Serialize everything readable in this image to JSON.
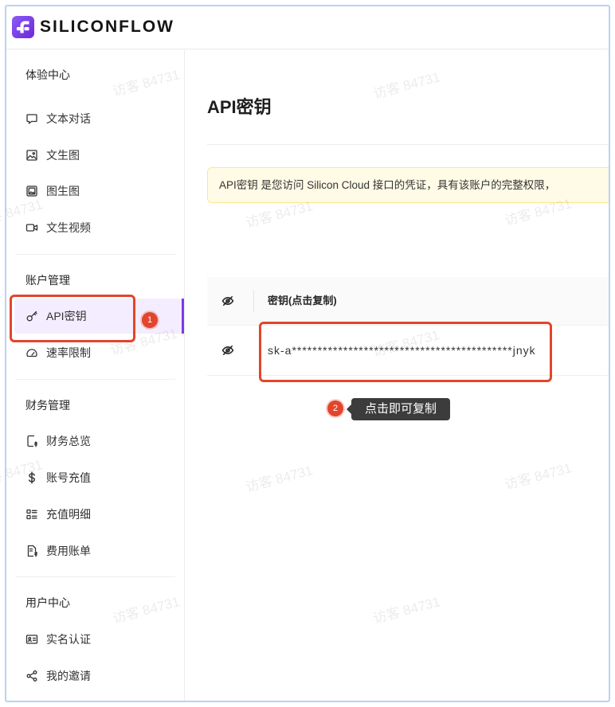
{
  "brand": {
    "name": "SILICONFLOW",
    "logo_icon": "siliconflow-logo-icon"
  },
  "sidebar": {
    "sections": [
      {
        "title": "体验中心",
        "items": [
          {
            "label": "文本对话",
            "icon": "chat-icon"
          },
          {
            "label": "文生图",
            "icon": "image-icon"
          },
          {
            "label": "图生图",
            "icon": "image-to-image-icon"
          },
          {
            "label": "文生视频",
            "icon": "video-icon"
          }
        ]
      },
      {
        "title": "账户管理",
        "items": [
          {
            "label": "API密钥",
            "icon": "key-icon",
            "active": true
          },
          {
            "label": "速率限制",
            "icon": "gauge-icon"
          }
        ]
      },
      {
        "title": "财务管理",
        "items": [
          {
            "label": "财务总览",
            "icon": "finance-overview-icon"
          },
          {
            "label": "账号充值",
            "icon": "dollar-icon"
          },
          {
            "label": "充值明细",
            "icon": "list-icon"
          },
          {
            "label": "费用账单",
            "icon": "bill-icon"
          }
        ]
      },
      {
        "title": "用户中心",
        "items": [
          {
            "label": "实名认证",
            "icon": "id-card-icon"
          },
          {
            "label": "我的邀请",
            "icon": "share-icon"
          }
        ]
      }
    ]
  },
  "main": {
    "title": "API密钥",
    "notice": "API密钥 是您访问 Silicon Cloud 接口的凭证，具有该账户的完整权限，",
    "table": {
      "header_icon": "eye-slash-icon",
      "key_header": "密钥(点击复制)",
      "rows": [
        {
          "visibility_icon": "eye-slash-icon",
          "key": "sk-a*******************************************jnyk"
        }
      ]
    }
  },
  "annotations": {
    "step_1": "1",
    "step_2": "2",
    "tooltip": "点击即可复制"
  },
  "watermark": "访客 84731",
  "colors": {
    "accent": "#7c3aed",
    "active_bg": "#f4edff",
    "annotation_red": "#e2452b",
    "notice_bg": "#fffbe6",
    "notice_border": "#ffe58f",
    "tooltip_bg": "#3c3c3c",
    "frame": "#b9d2f1"
  }
}
